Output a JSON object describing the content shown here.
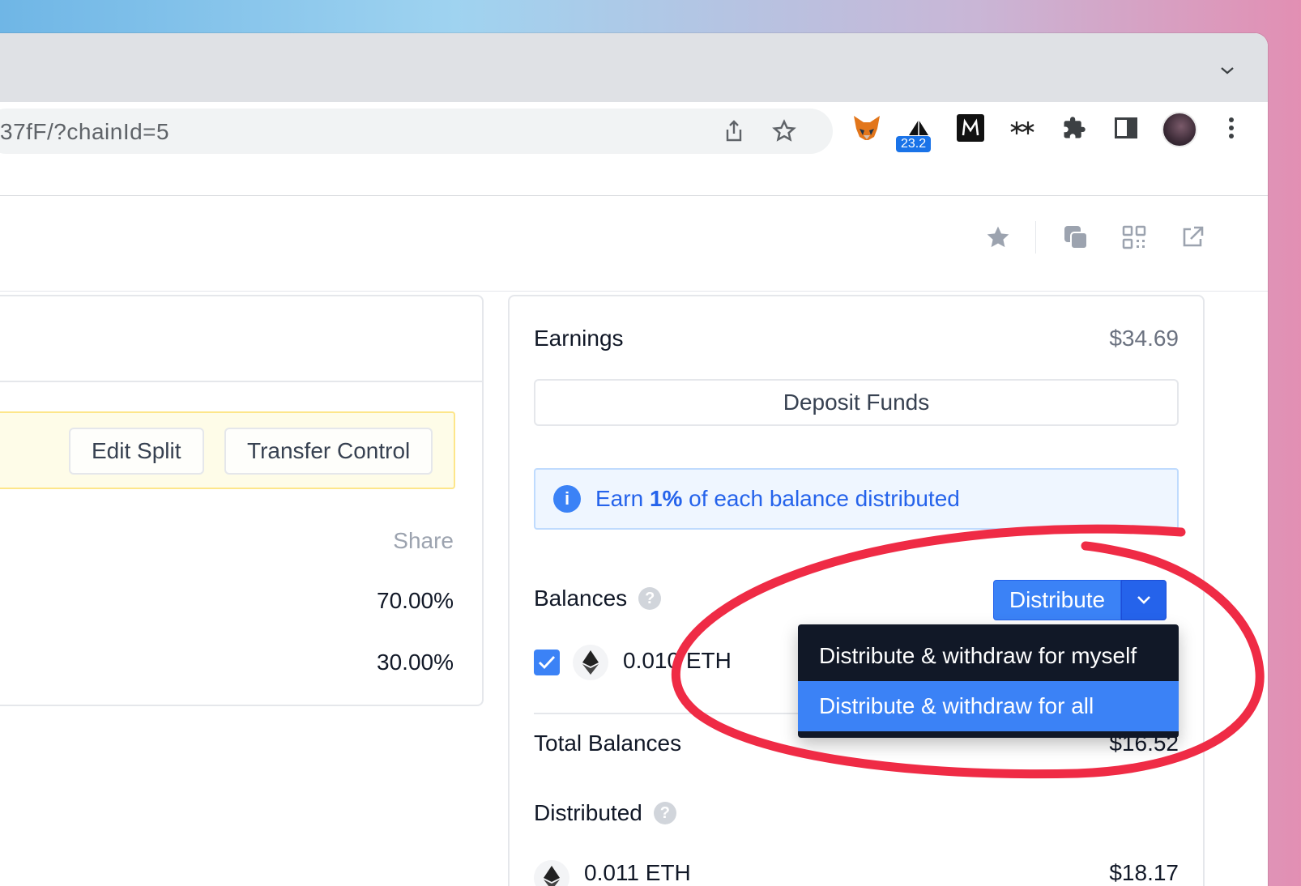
{
  "browser": {
    "url": "37fF/?chainId=5",
    "extensions": [
      {
        "name": "metamask"
      },
      {
        "name": "gas-price",
        "badge": "23.2"
      },
      {
        "name": "mirror"
      },
      {
        "name": "sparkle"
      },
      {
        "name": "puzzle"
      },
      {
        "name": "sidepanel"
      }
    ]
  },
  "split_panel": {
    "buttons": {
      "edit_split": "Edit Split",
      "transfer_control": "Transfer Control"
    },
    "share_header": "Share",
    "shares": [
      "70.00%",
      "30.00%"
    ]
  },
  "earnings": {
    "title": "Earnings",
    "amount": "$34.69",
    "deposit_label": "Deposit Funds",
    "info": {
      "prefix": "Earn ",
      "highlight": "1%",
      "suffix": " of each balance distributed"
    },
    "balances_label": "Balances",
    "distribute_label": "Distribute",
    "balance_token": "0.010 ETH",
    "total_label": "Total Balances",
    "total_value": "$16.52",
    "distributed_label": "Distributed",
    "distributed_token": "0.011 ETH",
    "distributed_value": "$18.17"
  },
  "menu": {
    "items": [
      "Distribute & withdraw for myself",
      "Distribute & withdraw for all"
    ],
    "active_index": 1
  },
  "colors": {
    "accent": "#3b82f6",
    "annotation": "#ef2b45",
    "menu_bg": "#111827",
    "notice_bg": "#fefce8"
  }
}
